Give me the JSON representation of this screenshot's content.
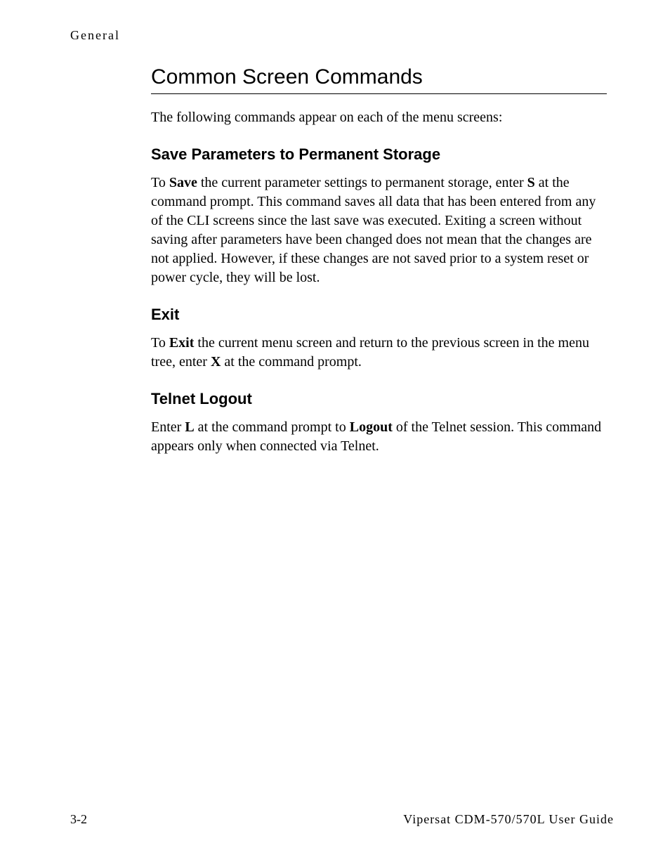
{
  "header": {
    "running_head": "General"
  },
  "section": {
    "title": "Common Screen Commands",
    "intro": "The following commands appear on each of the menu screens:"
  },
  "save": {
    "heading": "Save Parameters to Permanent Storage",
    "p1_a": "To ",
    "p1_b": "Save",
    "p1_c": " the current parameter settings to permanent storage, enter ",
    "p1_d": "S",
    "p1_e": " at the command prompt. This command saves all data that has been entered from any of the CLI screens since the last save was executed. Exiting a screen without saving after parameters have been changed does not mean that the changes are not applied. However, if these changes are not saved prior to a system reset or power cycle, they will be lost."
  },
  "exit": {
    "heading": "Exit",
    "p1_a": "To ",
    "p1_b": "Exit",
    "p1_c": " the current menu screen and return to the previous screen in the menu tree, enter ",
    "p1_d": "X",
    "p1_e": " at the command prompt."
  },
  "telnet": {
    "heading": "Telnet Logout",
    "p1_a": "Enter ",
    "p1_b": "L",
    "p1_c": " at the command prompt to ",
    "p1_d": "Logout",
    "p1_e": " of the Telnet session. This command appears only when connected via Telnet."
  },
  "footer": {
    "page_number": "3-2",
    "guide_title": "Vipersat CDM-570/570L User Guide"
  }
}
